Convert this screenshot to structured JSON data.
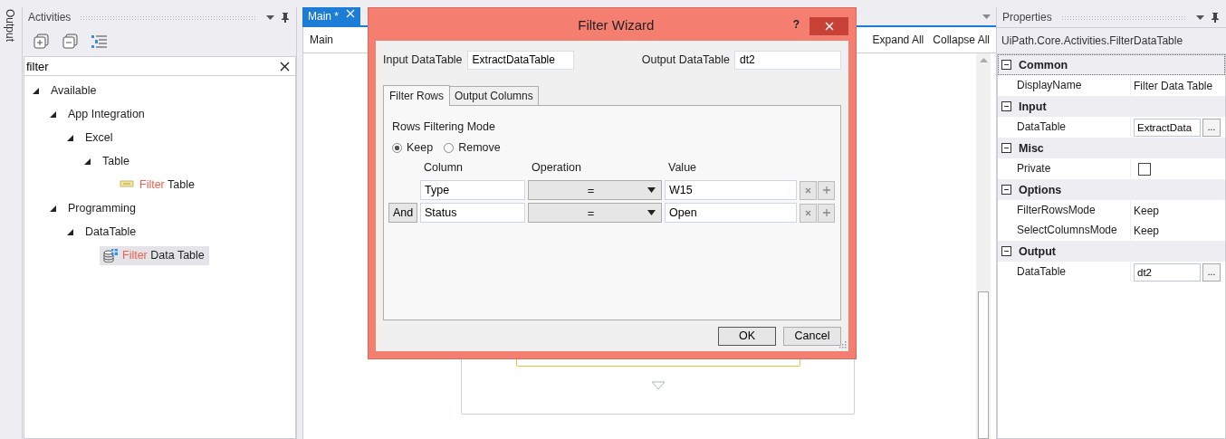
{
  "side_strip": {
    "label": "Output"
  },
  "activities": {
    "title": "Activities",
    "search": {
      "value": "filter"
    },
    "tree": [
      {
        "label": "Available",
        "expanded": true,
        "selected": false,
        "children": [
          {
            "label": "App Integration",
            "expanded": true,
            "selected": false,
            "children": [
              {
                "label": "Excel",
                "expanded": true,
                "selected": false,
                "children": [
                  {
                    "label": "Table",
                    "expanded": true,
                    "selected": false,
                    "children": [
                      {
                        "match": "Filter",
                        "label": " Table",
                        "kind": "excel-activity",
                        "selected": false
                      }
                    ]
                  }
                ]
              }
            ]
          },
          {
            "label": "Programming",
            "expanded": true,
            "selected": false,
            "children": [
              {
                "label": "DataTable",
                "expanded": true,
                "selected": false,
                "children": [
                  {
                    "match": "Filter",
                    "label": " Data Table",
                    "kind": "datatable-activity",
                    "selected": true
                  }
                ]
              }
            ]
          }
        ]
      }
    ]
  },
  "designer": {
    "tabs": [
      {
        "label": "Main *",
        "selected": true
      }
    ],
    "breadcrumb": "Main",
    "actions": [
      "Expand All",
      "Collapse All"
    ]
  },
  "dialog": {
    "title": "Filter Wizard",
    "help": "?",
    "input": {
      "label": "Input DataTable",
      "value": "ExtractDataTable"
    },
    "output": {
      "label": "Output DataTable",
      "value": "dt2"
    },
    "tabs": [
      {
        "label": "Filter Rows",
        "selected": true
      },
      {
        "label": "Output Columns",
        "selected": false
      }
    ],
    "mode": {
      "title": "Rows Filtering Mode",
      "options": [
        {
          "label": "Keep",
          "selected": true
        },
        {
          "label": "Remove",
          "selected": false
        }
      ]
    },
    "columns": [
      "Column",
      "Operation",
      "Value"
    ],
    "rows": [
      {
        "column": "Type",
        "operation": "=",
        "value": "W15"
      },
      {
        "connector": "And",
        "column": "Status",
        "operation": "=",
        "value": "Open"
      }
    ],
    "buttons": [
      {
        "label": "OK",
        "default": true
      },
      {
        "label": "Cancel",
        "default": false
      }
    ]
  },
  "properties": {
    "title": "Properties",
    "type_name": "UiPath.Core.Activities.FilterDataTable",
    "categories": [
      {
        "name": "Common",
        "expanded": true,
        "focused": true,
        "rows": [
          {
            "kind": "text",
            "name": "DisplayName",
            "value": "Filter Data Table"
          }
        ]
      },
      {
        "name": "Input",
        "expanded": true,
        "focused": false,
        "rows": [
          {
            "kind": "field",
            "name": "DataTable",
            "value": "ExtractData",
            "button": "..."
          }
        ]
      },
      {
        "name": "Misc",
        "expanded": true,
        "focused": false,
        "rows": [
          {
            "kind": "checkbox",
            "name": "Private",
            "checked": false
          }
        ]
      },
      {
        "name": "Options",
        "expanded": true,
        "focused": false,
        "rows": [
          {
            "kind": "text",
            "name": "FilterRowsMode",
            "value": "Keep"
          },
          {
            "kind": "text",
            "name": "SelectColumnsMode",
            "value": "Keep"
          }
        ]
      },
      {
        "name": "Output",
        "expanded": true,
        "focused": false,
        "rows": [
          {
            "kind": "field",
            "name": "DataTable",
            "value": "dt2",
            "button": "..."
          }
        ]
      }
    ]
  }
}
